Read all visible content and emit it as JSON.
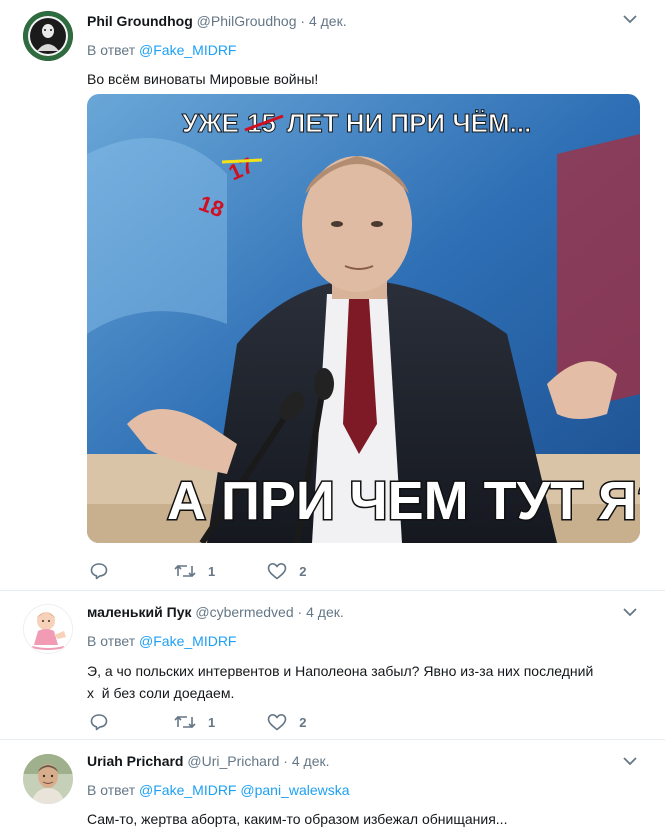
{
  "tweets": [
    {
      "name": "Phil Groundhog",
      "handle": "@PhilGroudhog",
      "dot": "·",
      "time": "4 дек.",
      "reply_prefix": "В ответ",
      "reply_to": [
        "@Fake_MIDRF"
      ],
      "text": "Во всём виноваты Мировые войны!",
      "meme": {
        "top": "УЖЕ",
        "strike1": "15",
        "top_rest": "ЛЕТ НИ ПРИ ЧЁМ...",
        "strike2": "17",
        "red": "18",
        "bottom": "А ПРИ ЧЕМ ТУТ Я?"
      },
      "retweets": "1",
      "likes": "2"
    },
    {
      "name": "маленький Пук",
      "handle": "@cybermedved",
      "dot": "·",
      "time": "4 дек.",
      "reply_prefix": "В ответ",
      "reply_to": [
        "@Fake_MIDRF"
      ],
      "text_line1": "Э, а чо польских интервентов и Наполеона забыл? Явно из-за них последний",
      "text_line2": "х  й без соли доедаем.",
      "retweets": "1",
      "likes": "2"
    },
    {
      "name": "Uriah Prichard",
      "handle": "@Uri_Prichard",
      "dot": "·",
      "time": "4 дек.",
      "reply_prefix": "В ответ",
      "reply_to": [
        "@Fake_MIDRF",
        "@pani_walewska"
      ],
      "text": "Сам-то, жертва аборта, каким-то образом избежал обнищания..."
    }
  ],
  "colors": {
    "accent": "#1da1f2",
    "secondary_text": "#657786",
    "divider": "#e6ecf0"
  },
  "icons": [
    "chevron-down-icon",
    "reply-icon",
    "retweet-icon",
    "like-icon"
  ]
}
